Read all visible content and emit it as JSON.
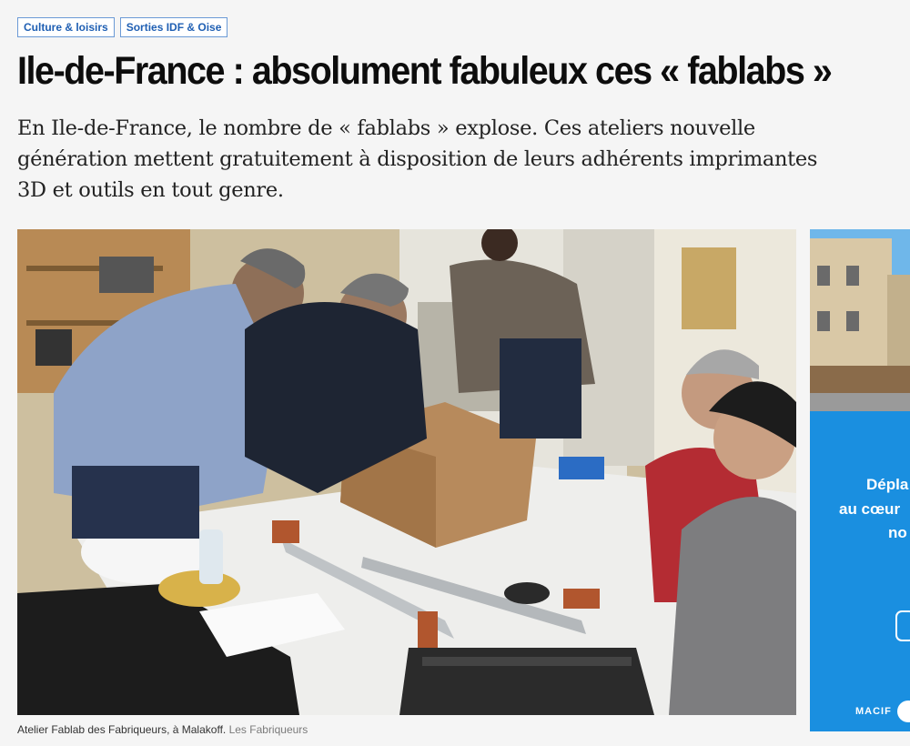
{
  "tags": [
    "Culture & loisirs",
    "Sorties IDF & Oise"
  ],
  "title": "Ile-de-France : absolument fabuleux ces « fablabs »",
  "lead": "En Ile-de-France, le nombre de « fablabs » explose. Ces ateliers nouvelle génération mettent gratuitement à disposition de leurs adhérents imprimantes 3D et outils en tout genre.",
  "caption": {
    "text": "Atelier Fablab des Fabriqueurs, à Malakoff.",
    "credit": "Les Fabriqueurs"
  },
  "ad": {
    "line1": "Dépla",
    "line2": "au cœur",
    "line3": "no",
    "brand": "MACIF",
    "colors": {
      "background": "#1a8fe0",
      "sky": "#6fb7ea"
    }
  },
  "colors": {
    "tag_border": "#6b9ad6",
    "tag_text": "#1f5fb3",
    "credit": "#7a7a7a"
  }
}
